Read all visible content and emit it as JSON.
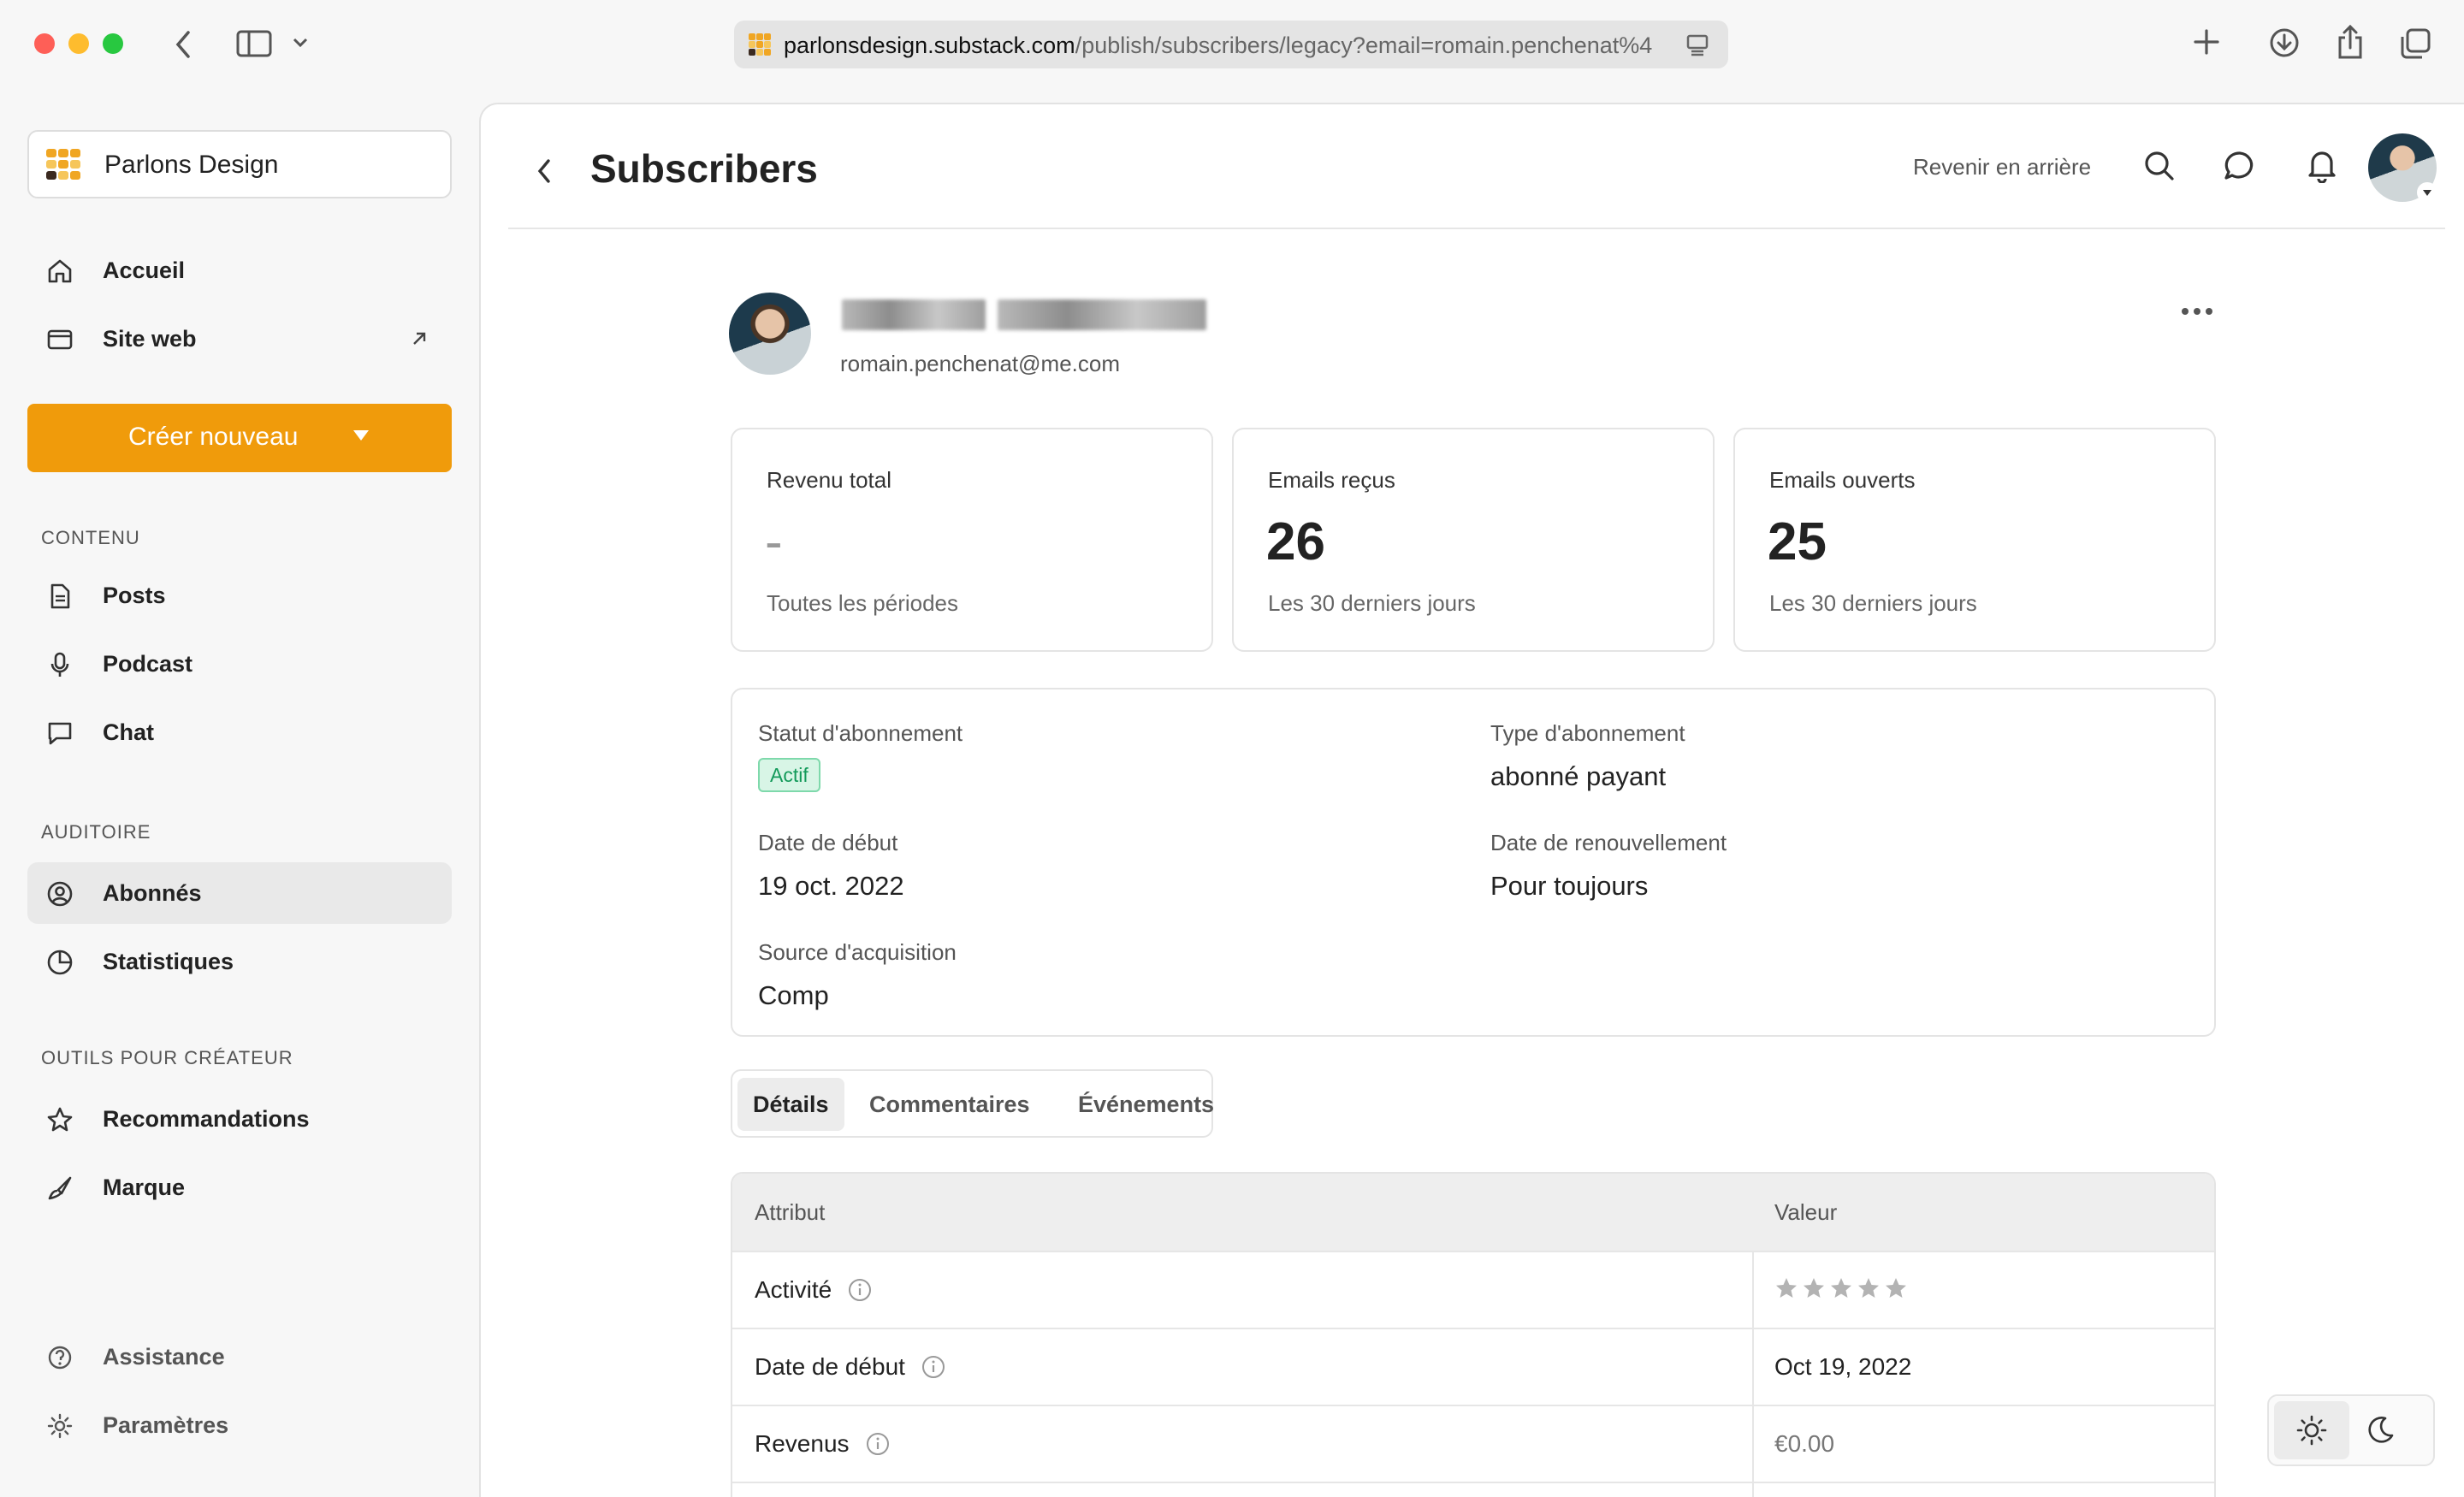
{
  "browser": {
    "url_domain": "parlonsdesign.substack.com",
    "url_path": "/publish/subscribers/legacy?email=romain.penchenat%4"
  },
  "sidebar": {
    "publication": "Parlons Design",
    "top_items": [
      {
        "label": "Accueil",
        "icon": "home-icon"
      },
      {
        "label": "Site web",
        "icon": "browser-window-icon"
      }
    ],
    "create_label": "Créer nouveau",
    "sections": {
      "contenu": "CONTENU",
      "auditoire": "AUDITOIRE",
      "outils": "OUTILS POUR CRÉATEUR"
    },
    "contenu_items": [
      {
        "label": "Posts",
        "icon": "document-icon"
      },
      {
        "label": "Podcast",
        "icon": "microphone-icon"
      },
      {
        "label": "Chat",
        "icon": "chat-bubble-icon"
      }
    ],
    "auditoire_items": [
      {
        "label": "Abonnés",
        "icon": "user-circle-icon",
        "active": true
      },
      {
        "label": "Statistiques",
        "icon": "pie-chart-icon"
      }
    ],
    "outils_items": [
      {
        "label": "Recommandations",
        "icon": "star-icon"
      },
      {
        "label": "Marque",
        "icon": "brush-icon"
      }
    ],
    "bottom_items": [
      {
        "label": "Assistance",
        "icon": "help-circle-icon"
      },
      {
        "label": "Paramètres",
        "icon": "gear-icon"
      }
    ]
  },
  "header": {
    "title": "Subscribers",
    "back_link": "Revenir en arrière"
  },
  "subscriber": {
    "email": "romain.penchenat@me.com"
  },
  "stats": [
    {
      "label": "Revenu total",
      "value": "-",
      "sub": "Toutes les périodes"
    },
    {
      "label": "Emails reçus",
      "value": "26",
      "sub": "Les 30 derniers jours"
    },
    {
      "label": "Emails ouverts",
      "value": "25",
      "sub": "Les 30 derniers jours"
    }
  ],
  "subscription": {
    "status_label": "Statut d'abonnement",
    "status_value": "Actif",
    "type_label": "Type d'abonnement",
    "type_value": "abonné payant",
    "start_label": "Date de début",
    "start_value": "19 oct. 2022",
    "renewal_label": "Date de renouvellement",
    "renewal_value": "Pour toujours",
    "source_label": "Source d'acquisition",
    "source_value": "Comp"
  },
  "tabs": [
    "Détails",
    "Commentaires",
    "Événements"
  ],
  "table": {
    "headers": [
      "Attribut",
      "Valeur"
    ],
    "rows": [
      {
        "attribute": "Activité",
        "value": "★★★★★"
      },
      {
        "attribute": "Date de début",
        "value": "Oct 19, 2022"
      },
      {
        "attribute": "Revenus",
        "value": "€0.00"
      }
    ]
  },
  "colors": {
    "accent": "#f09b0b",
    "active_badge": "#139a5a"
  }
}
